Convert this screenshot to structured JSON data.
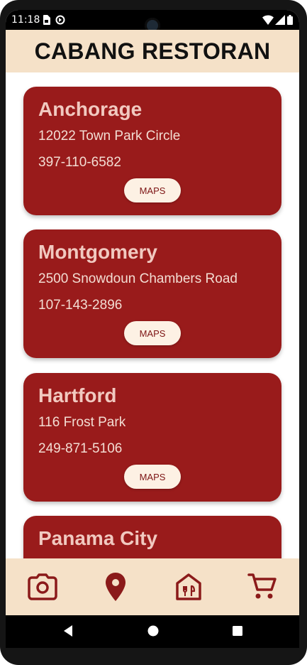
{
  "status_bar": {
    "time": "11:18"
  },
  "header": {
    "title": "CABANG RESTORAN"
  },
  "branches": [
    {
      "name": "Anchorage",
      "address": "12022 Town Park Circle",
      "phone": "397-110-6582",
      "button_label": "MAPS"
    },
    {
      "name": "Montgomery",
      "address": "2500 Snowdoun Chambers Road",
      "phone": "107-143-2896",
      "button_label": "MAPS"
    },
    {
      "name": "Hartford",
      "address": "116 Frost Park",
      "phone": "249-871-5106",
      "button_label": "MAPS"
    },
    {
      "name": "Panama City"
    }
  ],
  "bottom_nav": [
    {
      "icon": "camera-icon"
    },
    {
      "icon": "location-pin-icon"
    },
    {
      "icon": "restaurant-icon"
    },
    {
      "icon": "cart-icon"
    }
  ],
  "colors": {
    "accent": "#991b1b",
    "header_bg": "#f5e1c8",
    "button_bg": "#fdf1e4",
    "icon": "#8b1a1a"
  }
}
